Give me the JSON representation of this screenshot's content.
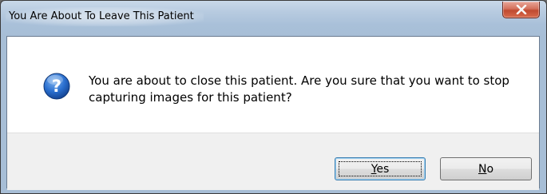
{
  "window": {
    "title": "You Are About To Leave This Patient"
  },
  "dialog": {
    "icon": "question-icon",
    "message": "You are about to close this patient.  Are you sure that you want to stop capturing images for this patient?"
  },
  "buttons": {
    "yes": {
      "accel": "Y",
      "rest": "es"
    },
    "no": {
      "accel": "N",
      "rest": "o"
    }
  },
  "colors": {
    "close_button": "#c04a30",
    "icon_blue": "#1f5fb8",
    "focus_border": "#3c7fb1"
  }
}
